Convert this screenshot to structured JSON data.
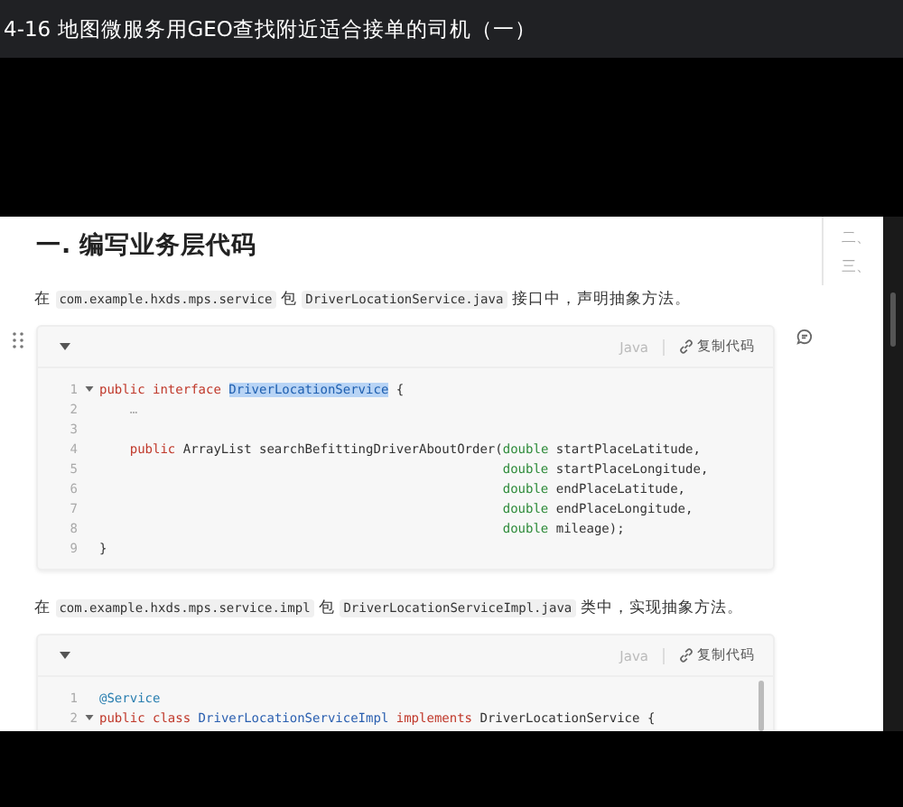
{
  "player": {
    "title": "4-16 地图微服务用GEO查找附近适合接单的司机（一）"
  },
  "document": {
    "toc": [
      "二、",
      "三、"
    ],
    "heading": "一. 编写业务层代码",
    "sections": [
      {
        "intro": [
          {
            "kind": "text",
            "text": "在 "
          },
          {
            "kind": "code",
            "text": "com.example.hxds.mps.service"
          },
          {
            "kind": "text",
            "text": " 包 "
          },
          {
            "kind": "code",
            "text": "DriverLocationService.java"
          },
          {
            "kind": "text",
            "text": " 接口中，声明抽象方法。"
          }
        ],
        "code_block": {
          "has_handle": true,
          "language": "Java",
          "copy_label": "复制代码",
          "scrollbar": false,
          "lines": [
            {
              "number": "1",
              "foldable": true,
              "tokens": [
                {
                  "kind": "keyword",
                  "text": "public interface "
                },
                {
                  "kind": "selected",
                  "text": "DriverLocationService"
                },
                {
                  "kind": "plain",
                  "text": " {"
                }
              ]
            },
            {
              "number": "2",
              "foldable": false,
              "tokens": [
                {
                  "kind": "muted",
                  "text": "    …"
                }
              ]
            },
            {
              "number": "3",
              "foldable": false
            },
            {
              "number": "4",
              "foldable": false,
              "tokens": [
                {
                  "kind": "keyword",
                  "text": "    public "
                },
                {
                  "kind": "plain",
                  "text": "ArrayList searchBefittingDriverAboutOrder("
                },
                {
                  "kind": "type",
                  "text": "double"
                },
                {
                  "kind": "plain",
                  "text": " startPlaceLatitude,"
                }
              ]
            },
            {
              "number": "5",
              "foldable": false,
              "tokens": [
                {
                  "kind": "type",
                  "text": "                                                     double"
                },
                {
                  "kind": "plain",
                  "text": " startPlaceLongitude,"
                }
              ]
            },
            {
              "number": "6",
              "foldable": false,
              "tokens": [
                {
                  "kind": "type",
                  "text": "                                                     double"
                },
                {
                  "kind": "plain",
                  "text": " endPlaceLatitude,"
                }
              ]
            },
            {
              "number": "7",
              "foldable": false,
              "tokens": [
                {
                  "kind": "type",
                  "text": "                                                     double"
                },
                {
                  "kind": "plain",
                  "text": " endPlaceLongitude,"
                }
              ]
            },
            {
              "number": "8",
              "foldable": false,
              "tokens": [
                {
                  "kind": "type",
                  "text": "                                                     double"
                },
                {
                  "kind": "plain",
                  "text": " mileage);"
                }
              ]
            },
            {
              "number": "9",
              "foldable": false,
              "tokens": [
                {
                  "kind": "plain",
                  "text": "}"
                }
              ]
            }
          ]
        }
      },
      {
        "intro": [
          {
            "kind": "text",
            "text": "在 "
          },
          {
            "kind": "code",
            "text": "com.example.hxds.mps.service.impl"
          },
          {
            "kind": "text",
            "text": " 包 "
          },
          {
            "kind": "code",
            "text": "DriverLocationServiceImpl.java"
          },
          {
            "kind": "text",
            "text": " 类中，实现抽象方法。"
          }
        ],
        "code_block": {
          "has_handle": false,
          "language": "Java",
          "copy_label": "复制代码",
          "scrollbar": true,
          "lines": [
            {
              "number": "1",
              "foldable": false,
              "tokens": [
                {
                  "kind": "annotation",
                  "text": "@Service"
                }
              ]
            },
            {
              "number": "2",
              "foldable": true,
              "tokens": [
                {
                  "kind": "keyword",
                  "text": "public class "
                },
                {
                  "kind": "name",
                  "text": "DriverLocationServiceImpl"
                },
                {
                  "kind": "keyword",
                  "text": " implements "
                },
                {
                  "kind": "plain",
                  "text": "DriverLocationService {"
                }
              ]
            }
          ]
        }
      }
    ]
  }
}
